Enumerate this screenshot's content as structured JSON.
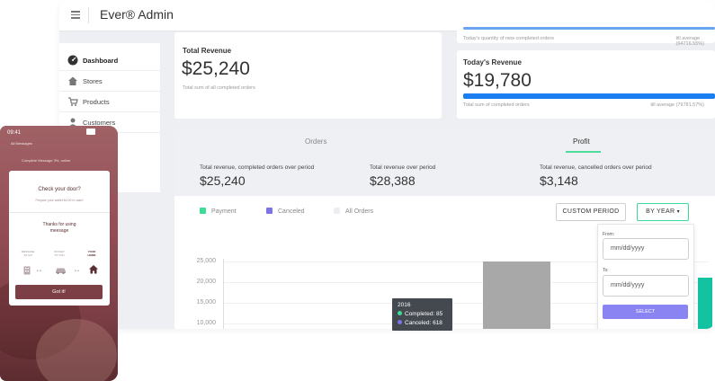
{
  "app": {
    "title": "Ever® Admin"
  },
  "sidebar": {
    "items": [
      {
        "label": "Dashboard",
        "icon": "dashboard-icon",
        "active": true
      },
      {
        "label": "Stores",
        "icon": "store-icon",
        "active": false
      },
      {
        "label": "Products",
        "icon": "products-icon",
        "active": false
      },
      {
        "label": "Customers",
        "icon": "customers-icon",
        "active": false
      }
    ]
  },
  "top_card": {
    "sub": "Today's quantity of new completed orders",
    "note": "till average (64716.55%)",
    "progress": 1.0
  },
  "total_revenue": {
    "label": "Total Revenue",
    "value": "$25,240",
    "sub": "Total sum of all completed orders"
  },
  "todays_revenue": {
    "label": "Today's Revenue",
    "value": "$19,780",
    "sub": "Total sum of completed orders",
    "note": "till average (79781.57%)",
    "progress": 1.0
  },
  "tabs": [
    {
      "label": "Orders",
      "active": false
    },
    {
      "label": "Profit",
      "active": true
    }
  ],
  "stats": [
    {
      "label": "Total revenue, completed orders over period",
      "value": "$25,240"
    },
    {
      "label": "Total revenue over period",
      "value": "$28,388"
    },
    {
      "label": "Total revenue, cancelled orders over period",
      "value": "$3,148"
    }
  ],
  "legend": [
    {
      "label": "Payment",
      "color": "#3ddc97"
    },
    {
      "label": "Canceled",
      "color": "#7b73e8"
    },
    {
      "label": "All Orders",
      "color": "#eceef2"
    }
  ],
  "buttons": {
    "custom_period": "CUSTOM PERIOD",
    "by_year": "BY YEAR"
  },
  "period_form": {
    "from_label": "From:",
    "from_placeholder": "mm/dd/yyyy",
    "to_label": "To:",
    "to_placeholder": "mm/dd/yyyy",
    "select_label": "SELECT"
  },
  "chart_data": {
    "type": "bar",
    "yticks": [
      "25,000",
      "20,000",
      "15,000",
      "10,000"
    ],
    "ylim": [
      10000,
      25000
    ],
    "bars": [
      {
        "name": "2016 total",
        "value": 25000,
        "color": "#a8a8a8"
      },
      {
        "name": "payment",
        "value": 21000,
        "color": "#12c2a0"
      },
      {
        "name": "all orders",
        "value": 21000,
        "color": "#dde3ee"
      }
    ],
    "tooltip": {
      "year": "2016",
      "completed": "Completed: 85",
      "canceled": "Canceled: 618"
    }
  },
  "phone": {
    "time": "09:41",
    "back_label": "All Messages",
    "header_text": "Complete Message 3%, online",
    "modal_title": "Check your door?",
    "modal_sub": "Prepare your wallet $4.00 in cash!",
    "thanks": "Thanks for using\nmeesage",
    "steps": [
      {
        "label": "MESSAGE\nTO GO",
        "current": false
      },
      {
        "label": "ON WAY\nTO YOU",
        "current": false
      },
      {
        "label": "YOUR\nHOME",
        "current": true
      }
    ],
    "cta": "Got it!"
  }
}
